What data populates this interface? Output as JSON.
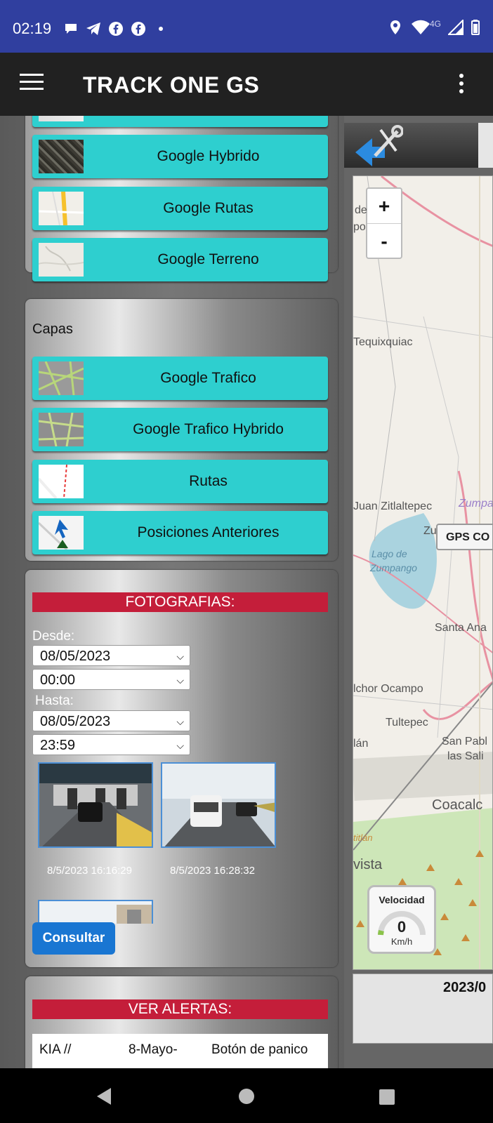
{
  "status_bar": {
    "time": "02:19",
    "network": "4G",
    "left_icons": [
      "chat-bubble-icon",
      "telegram-icon",
      "facebook-icon",
      "facebook-icon",
      "dot-icon"
    ],
    "right_icons": [
      "location-icon",
      "wifi-icon",
      "cell-signal-icon",
      "battery-icon"
    ]
  },
  "app_bar": {
    "title": "TRACK ONE GS"
  },
  "map_types": [
    {
      "label": "Google Hybrido",
      "thumb": "satellite"
    },
    {
      "label": "Google Rutas",
      "thumb": "roads"
    },
    {
      "label": "Google Terreno",
      "thumb": "terrain"
    }
  ],
  "capas": {
    "heading": "Capas",
    "items": [
      {
        "label": "Google Trafico",
        "thumb": "traffic"
      },
      {
        "label": "Google Trafico Hybrido",
        "thumb": "traffic"
      },
      {
        "label": "Rutas",
        "thumb": "route"
      },
      {
        "label": "Posiciones Anteriores",
        "thumb": "positions"
      }
    ]
  },
  "fotografias": {
    "title": "FOTOGRAFIAS:",
    "desde_label": "Desde:",
    "desde_date": "08/05/2023",
    "desde_time": "00:00",
    "hasta_label": "Hasta:",
    "hasta_date": "08/05/2023",
    "hasta_time": "23:59",
    "photos": [
      {
        "timestamp": "8/5/2023 16:16:29"
      },
      {
        "timestamp": "8/5/2023 16:28:32"
      }
    ],
    "consultar_label": "Consultar"
  },
  "alertas": {
    "title": "VER ALERTAS:",
    "row": {
      "vehicle": "KIA //",
      "date": "8-Mayo-",
      "type": "Botón de panico"
    }
  },
  "map": {
    "zoom_in": "+",
    "zoom_out": "-",
    "labels": [
      "de",
      "po",
      "Tequixquiac",
      "Juan Zitlaltepec",
      "Zumpango",
      "Lago de",
      "Zumpango",
      "Zu",
      "Santa Ana",
      "lchor Ocampo",
      "Tultepec",
      "San Pabl",
      "las Sali",
      "lán",
      "Coacalc",
      "vista",
      "titlán"
    ],
    "gps_label": "GPS CO",
    "speed_title": "Velocidad",
    "speed_value": "0",
    "speed_unit": "Km/h",
    "date_label": "2023/0"
  },
  "colors": {
    "status_bar": "#303f9f",
    "app_bar": "#212121",
    "map_button": "#2ecfcf",
    "red_header": "#c41e3a",
    "consultar": "#1976d2"
  }
}
